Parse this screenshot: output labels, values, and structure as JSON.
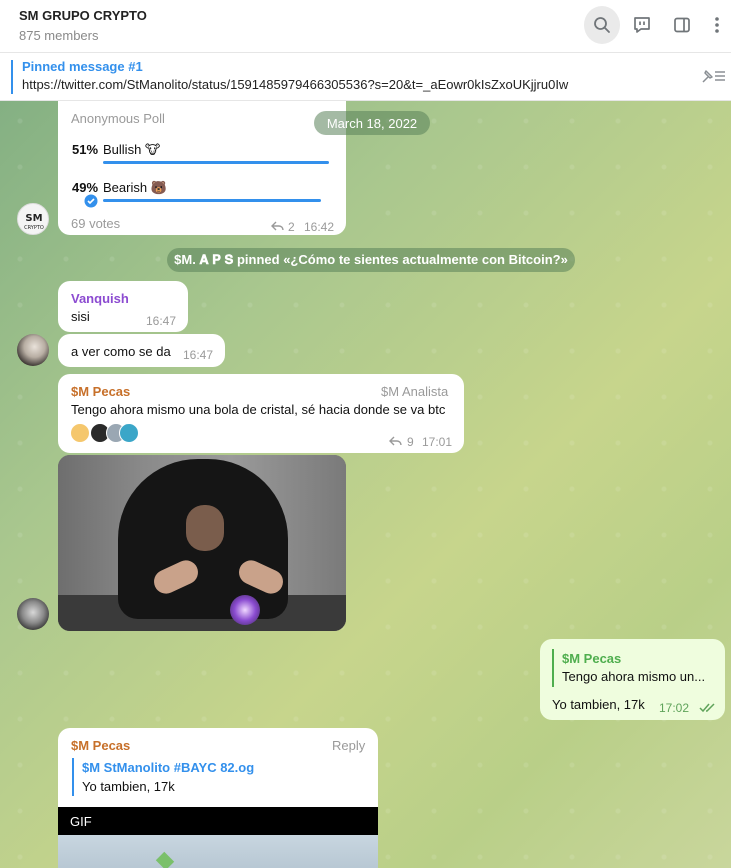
{
  "header": {
    "title": "SM GRUPO CRYPTO",
    "subtitle": "875 members",
    "icons": [
      "search-icon",
      "comments-icon",
      "sidebar-icon",
      "more-icon"
    ]
  },
  "pinned": {
    "title": "Pinned message #1",
    "text": "https://twitter.com/StManolito/status/1591485979466305536?s=20&t=_aEowr0kIsZxoUKjjru0Iw"
  },
  "chat": {
    "date_label": "March 18, 2022",
    "poll": {
      "type_label": "Anonymous Poll",
      "options": [
        {
          "percent": "51%",
          "label": "Bullish 🐮",
          "fraction": 0.51
        },
        {
          "percent": "49%",
          "label": "Bearish 🐻",
          "fraction": 0.49
        }
      ],
      "votes": "69 votes",
      "replies": "2",
      "time": "16:42"
    },
    "service": "$M. 𝐀 𝐏 𝐒 pinned «¿Cómo te sientes actualmente con Bitcoin?»",
    "msg_vanquish": {
      "name": "Vanquish",
      "text": "sisi",
      "time": "16:47"
    },
    "msg_vanquish2": {
      "text": "a ver como se da",
      "time": "16:47"
    },
    "msg_pecas1": {
      "name": "$M Pecas",
      "badge": "$M Analista",
      "text": "Tengo ahora mismo una bola de cristal, sé hacia donde se va btc",
      "replies": "9",
      "time": "17:01"
    },
    "msg_out": {
      "reply_name": "$M Pecas",
      "reply_text": "Tengo ahora mismo un...",
      "text": "Yo tambien, 17k",
      "time": "17:02"
    },
    "msg_pecas2": {
      "name": "$M Pecas",
      "reply_action": "Reply",
      "reply_name": "$M StManolito #BAYC 82.og",
      "reply_text": "Yo tambien, 17k",
      "gif_label": "GIF"
    }
  },
  "colors": {
    "accent": "#3390ec",
    "name_pecas": "#c7702a",
    "name_vanquish": "#8c4bd1",
    "out_bubble": "#effdde"
  }
}
